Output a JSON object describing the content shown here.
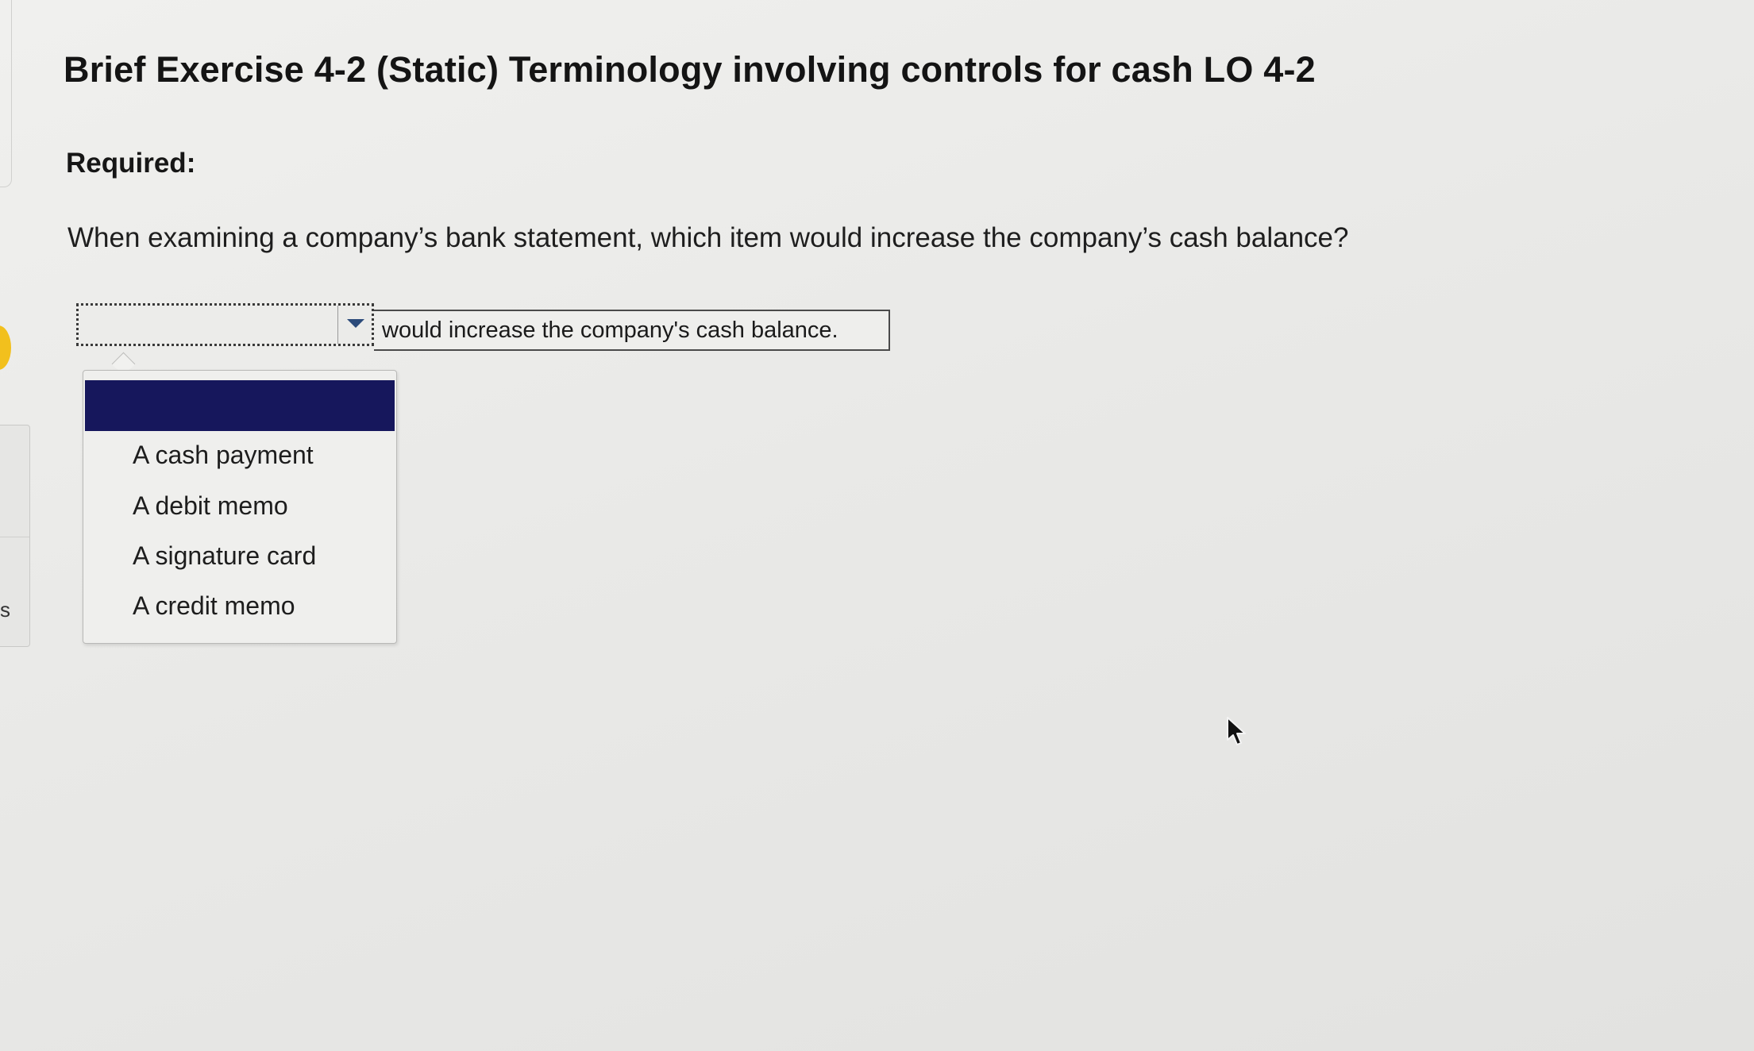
{
  "exercise": {
    "title": "Brief Exercise 4-2 (Static) Terminology involving controls for cash LO 4-2",
    "required_label": "Required:",
    "question": "When examining a company’s bank statement, which item would increase the company’s cash balance?"
  },
  "answer": {
    "selected_value": "",
    "suffix_text": "would increase the company's cash balance."
  },
  "dropdown": {
    "highlighted_option": "",
    "options": [
      "A cash payment",
      "A debit memo",
      "A signature card",
      "A credit memo"
    ]
  },
  "left_panel": {
    "letter": "s"
  },
  "colors": {
    "highlight": "#16175c",
    "accent_dot": "#f2c01d",
    "arrow": "#2b4a7a"
  },
  "icons": {
    "select_arrow": "chevron-down-icon",
    "pointer": "mouse-pointer-icon"
  }
}
